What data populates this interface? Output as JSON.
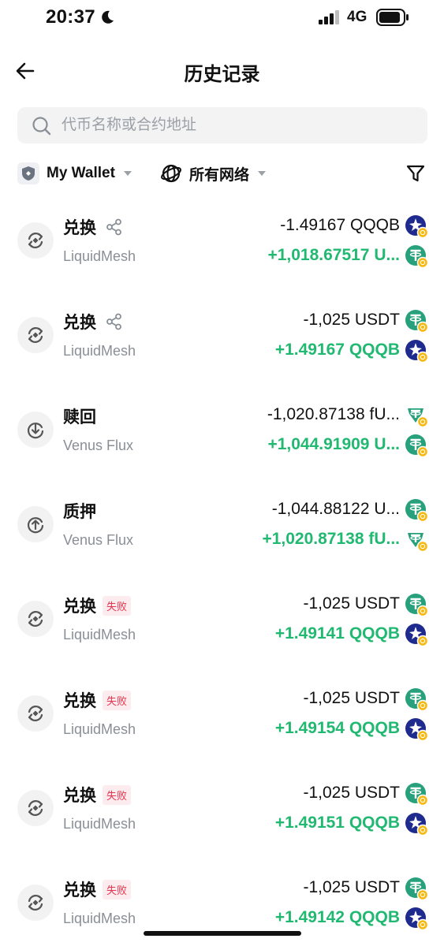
{
  "status": {
    "time": "20:37",
    "network": "4G"
  },
  "header": {
    "title": "历史记录"
  },
  "search": {
    "placeholder": "代币名称或合约地址"
  },
  "filters": {
    "wallet": "My Wallet",
    "network": "所有网络"
  },
  "failed_label": "失败",
  "colors": {
    "positive": "#21b971",
    "negative": "#111111",
    "failed_bg": "#fdecef",
    "failed_text": "#e5354e",
    "usdt_teal": "#26a17b",
    "qqqb_navy": "#1f2a8f"
  },
  "transactions": [
    {
      "type": "兑换",
      "icon": "swap-icon",
      "share": true,
      "failed": false,
      "protocol": "LiquidMesh",
      "out": "-1.49167 QQQB",
      "in": "+1,018.67517 U...",
      "out_coin": "qqqb",
      "in_coin": "usdt"
    },
    {
      "type": "兑换",
      "icon": "swap-icon",
      "share": true,
      "failed": false,
      "protocol": "LiquidMesh",
      "out": "-1,025 USDT",
      "in": "+1.49167 QQQB",
      "out_coin": "usdt",
      "in_coin": "qqqb"
    },
    {
      "type": "赎回",
      "icon": "redeem-icon",
      "share": false,
      "failed": false,
      "protocol": "Venus Flux",
      "out": "-1,020.87138 fU...",
      "in": "+1,044.91909 U...",
      "out_coin": "fusdt",
      "in_coin": "usdt"
    },
    {
      "type": "质押",
      "icon": "stake-icon",
      "share": false,
      "failed": false,
      "protocol": "Venus Flux",
      "out": "-1,044.88122 U...",
      "in": "+1,020.87138 fU...",
      "out_coin": "usdt",
      "in_coin": "fusdt"
    },
    {
      "type": "兑换",
      "icon": "swap-icon",
      "share": false,
      "failed": true,
      "protocol": "LiquidMesh",
      "out": "-1,025 USDT",
      "in": "+1.49141 QQQB",
      "out_coin": "usdt",
      "in_coin": "qqqb"
    },
    {
      "type": "兑换",
      "icon": "swap-icon",
      "share": false,
      "failed": true,
      "protocol": "LiquidMesh",
      "out": "-1,025 USDT",
      "in": "+1.49154 QQQB",
      "out_coin": "usdt",
      "in_coin": "qqqb"
    },
    {
      "type": "兑换",
      "icon": "swap-icon",
      "share": false,
      "failed": true,
      "protocol": "LiquidMesh",
      "out": "-1,025 USDT",
      "in": "+1.49151 QQQB",
      "out_coin": "usdt",
      "in_coin": "qqqb"
    },
    {
      "type": "兑换",
      "icon": "swap-icon",
      "share": false,
      "failed": true,
      "protocol": "LiquidMesh",
      "out": "-1,025 USDT",
      "in": "+1.49142 QQQB",
      "out_coin": "usdt",
      "in_coin": "qqqb"
    }
  ]
}
